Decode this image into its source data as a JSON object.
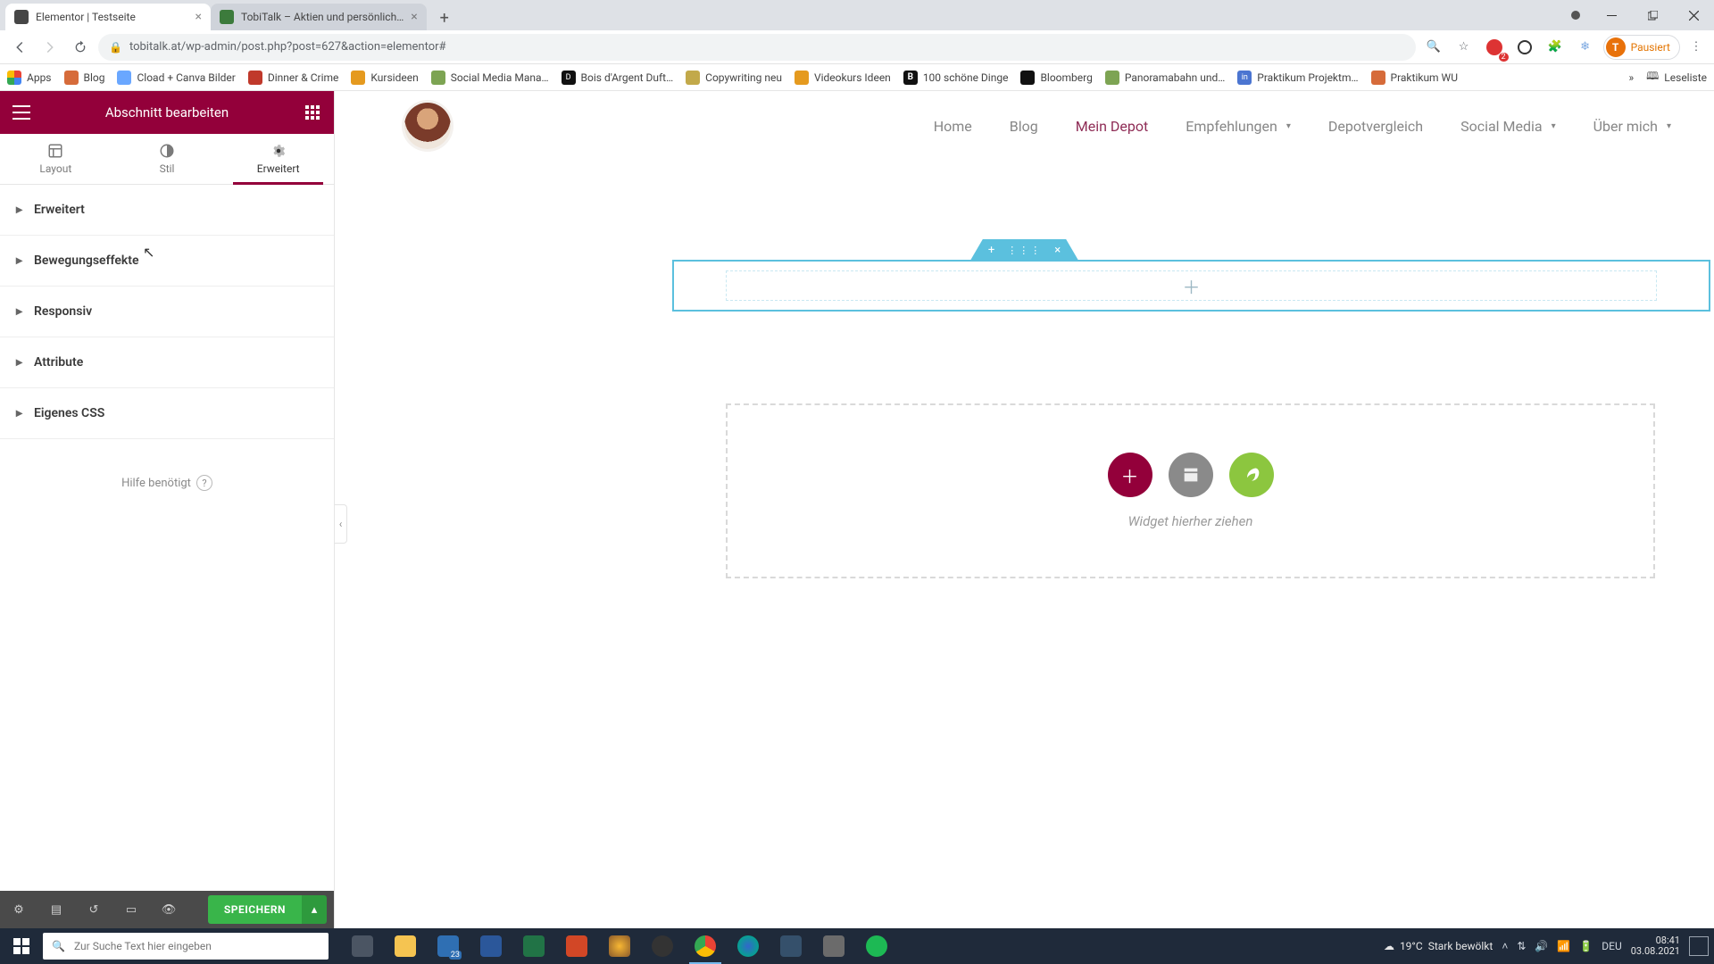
{
  "browser": {
    "tabs": [
      {
        "title": "Elementor | Testseite",
        "active": true
      },
      {
        "title": "TobiTalk – Aktien und persönlich…",
        "active": false
      }
    ],
    "url": "tobitalk.at/wp-admin/post.php?post=627&action=elementor#",
    "profile_label": "Pausiert",
    "profile_initial": "T",
    "bookmarks": [
      {
        "label": "Apps",
        "color": "#5f6368"
      },
      {
        "label": "Blog",
        "color": "#d66b3a"
      },
      {
        "label": "Cload + Canva Bilder",
        "color": "#6aa7ff"
      },
      {
        "label": "Dinner & Crime",
        "color": "#c0392b"
      },
      {
        "label": "Kursideen",
        "color": "#e59a1f"
      },
      {
        "label": "Social Media Mana…",
        "color": "#7da453"
      },
      {
        "label": "Bois d'Argent Duft…",
        "color": "#111"
      },
      {
        "label": "Copywriting neu",
        "color": "#c2a94a"
      },
      {
        "label": "Videokurs Ideen",
        "color": "#e59a1f"
      },
      {
        "label": "100 schöne Dinge",
        "color": "#111"
      },
      {
        "label": "Bloomberg",
        "color": "#111"
      },
      {
        "label": "Panoramabahn und…",
        "color": "#7da453"
      },
      {
        "label": "Praktikum Projektm…",
        "color": "#4b75d1"
      },
      {
        "label": "Praktikum WU",
        "color": "#d66b3a"
      }
    ],
    "readlist": "Leseliste"
  },
  "sidebar": {
    "title": "Abschnitt bearbeiten",
    "tabs": {
      "layout": "Layout",
      "style": "Stil",
      "advanced": "Erweitert"
    },
    "accordion": [
      "Erweitert",
      "Bewegungseffekte",
      "Responsiv",
      "Attribute",
      "Eigenes CSS"
    ],
    "help": "Hilfe benötigt",
    "save": "SPEICHERN"
  },
  "site": {
    "nav": [
      "Home",
      "Blog",
      "Mein Depot",
      "Empfehlungen",
      "Depotvergleich",
      "Social Media",
      "Über mich"
    ],
    "nav_dropdown": [
      3,
      5,
      6
    ],
    "nav_active": 2,
    "drop_hint": "Widget hierher ziehen"
  },
  "taskbar": {
    "search_placeholder": "Zur Suche Text hier eingeben",
    "weather_temp": "19°C",
    "weather_text": "Stark bewölkt",
    "lang": "DEU",
    "time": "08:41",
    "date": "03.08.2021"
  }
}
